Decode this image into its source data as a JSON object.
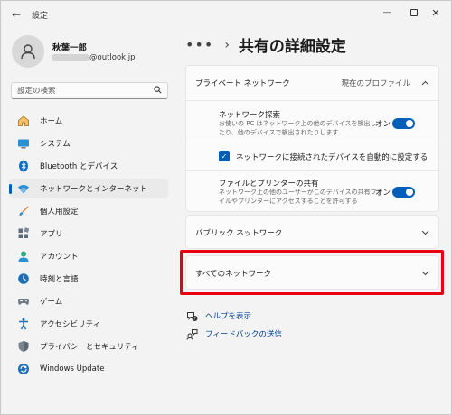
{
  "window": {
    "title": "設定",
    "back_glyph": "←",
    "minimize_glyph": "—",
    "close_glyph": "✕"
  },
  "profile": {
    "name": "秋葉一郎",
    "email_visible": "@outlook.jp"
  },
  "search": {
    "placeholder": "設定の検索"
  },
  "nav": {
    "items": [
      {
        "label": "ホーム",
        "icon": "home-icon"
      },
      {
        "label": "システム",
        "icon": "monitor-icon"
      },
      {
        "label": "Bluetooth とデバイス",
        "icon": "bluetooth-icon"
      },
      {
        "label": "ネットワークとインターネット",
        "icon": "wifi-icon",
        "selected": true
      },
      {
        "label": "個人用設定",
        "icon": "brush-icon"
      },
      {
        "label": "アプリ",
        "icon": "apps-icon"
      },
      {
        "label": "アカウント",
        "icon": "account-icon"
      },
      {
        "label": "時刻と言語",
        "icon": "time-language-icon"
      },
      {
        "label": "ゲーム",
        "icon": "gamepad-icon"
      },
      {
        "label": "アクセシビリティ",
        "icon": "accessibility-icon"
      },
      {
        "label": "プライバシーとセキュリティ",
        "icon": "shield-icon"
      },
      {
        "label": "Windows Update",
        "icon": "update-icon"
      }
    ]
  },
  "breadcrumb": {
    "more": "•••",
    "separator": "›",
    "title": "共有の詳細設定"
  },
  "private_network": {
    "title": "プライベート ネットワーク",
    "current_profile": "現在のプロファイル",
    "network_discovery": {
      "title": "ネットワーク探索",
      "desc_line1": "お使いの PC はネットワーク上の他のデバイスを検出し",
      "desc_line2": "たり、他のデバイスで検出されたりします",
      "state": "オン",
      "on": true
    },
    "auto_setup": {
      "label": "ネットワークに接続されたデバイスを自動的に設定する",
      "checked": true
    },
    "file_printer_sharing": {
      "title": "ファイルとプリンターの共有",
      "desc_line1": "ネットワーク上の他のユーザーがこのデバイスの共有ファ",
      "desc_line2": "イルやプリンターにアクセスすることを許可する",
      "state": "オン",
      "on": true
    }
  },
  "public_network": {
    "title": "パブリック ネットワーク"
  },
  "all_networks": {
    "title": "すべてのネットワーク"
  },
  "links": {
    "help": "ヘルプを表示",
    "feedback": "フィードバックの送信"
  },
  "colors": {
    "accent": "#005fb8",
    "highlight": "#e60012",
    "link": "#003e92"
  }
}
